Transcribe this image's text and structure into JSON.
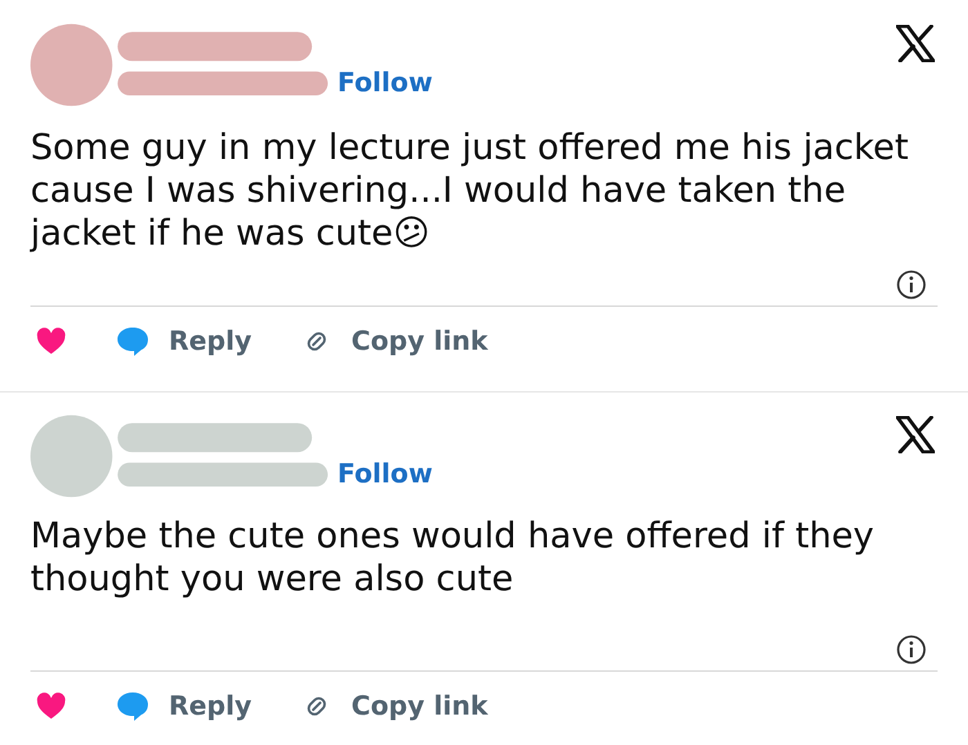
{
  "tweets": [
    {
      "color": "#e0b1b1",
      "follow": "Follow",
      "text": "Some guy in my lecture just offered me his jacket cause I was shivering...I would have taken the jacket if he was cute😕",
      "reply": "Reply",
      "copy_link": "Copy link"
    },
    {
      "color": "#cdd4d0",
      "follow": "Follow",
      "text": "Maybe the cute ones would have offered if they thought you were also cute",
      "reply": "Reply",
      "copy_link": "Copy link"
    }
  ]
}
